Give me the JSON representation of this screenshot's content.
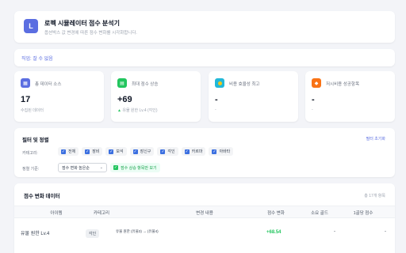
{
  "header": {
    "logo": "L",
    "title": "로펙 시뮬레이터 점수 분석기",
    "subtitle": "옵션박스 값 변경에 따른 점수 변화를 시각화합니다."
  },
  "job": {
    "label": "직업: 잘 수 없음"
  },
  "stats": [
    {
      "icon": "chart-bar-icon",
      "color": "#5b6ee1",
      "label": "총 데이터 소스",
      "value": "17",
      "sub": "수집된 데이터"
    },
    {
      "icon": "trend-up-icon",
      "color": "#22c55e",
      "label": "최대 점수 상승",
      "value": "+69",
      "sub_arrow": "▲",
      "sub": "유물 원한 Lv.4 (각인)"
    },
    {
      "icon": "gold-icon",
      "color": "#f5c518",
      "label": "비용 효율성 최고",
      "value": "-",
      "sub": "-"
    },
    {
      "icon": "gem-icon",
      "color": "#f97316",
      "label": "저시비용 성공항목",
      "value": "-",
      "sub": "-"
    }
  ],
  "filter": {
    "title": "필터 및 정렬",
    "reset": "필터 초기화",
    "category_label": "카테고리:",
    "categories": [
      "전체",
      "장비",
      "보석",
      "장신구",
      "각인",
      "카르마",
      "아바타"
    ],
    "sort_label": "정렬 기준:",
    "sort_value": "점수 변화 높은순",
    "only_increase": "점수 상승 항목만 보기"
  },
  "table": {
    "title": "점수 변화 데이터",
    "count": "총 17개 항목",
    "columns": [
      "아이템",
      "카테고리",
      "변경 내용",
      "점수 변화",
      "소요 골드",
      "1골당 점수"
    ],
    "rows": [
      {
        "item": "유물 원한 Lv.4",
        "category": "각인",
        "change": "유물 원한 (유물3) → (유물4)",
        "score": "+68.54",
        "gold": "-",
        "per_gold": "-"
      }
    ]
  }
}
